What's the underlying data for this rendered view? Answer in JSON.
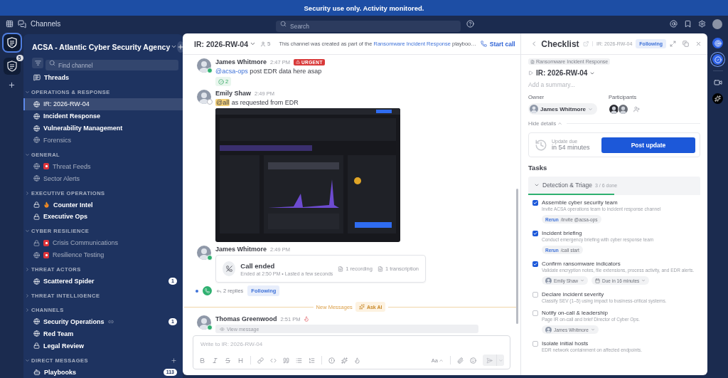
{
  "banner": {
    "text": "Security use only. Activity monitored."
  },
  "top_bar": {
    "product": "Channels",
    "search_placeholder": "Search"
  },
  "teams": [
    {
      "selected": true
    },
    {
      "selected": false,
      "badge": "5"
    }
  ],
  "sidebar": {
    "team_name": "ACSA - Atlantic Cyber Security Agency",
    "find_placeholder": "Find channel",
    "threads": "Threads",
    "sections": [
      {
        "title": "OPERATIONS & RESPONSE",
        "expanded": true,
        "channels": [
          {
            "name": "IR: 2026-RW-04",
            "kind": "public",
            "unread": false,
            "selected": true
          },
          {
            "name": "Incident Response",
            "kind": "public",
            "unread": true,
            "selected": false
          },
          {
            "name": "Vulnerability Management",
            "kind": "public",
            "unread": true,
            "selected": false
          },
          {
            "name": "Forensics",
            "kind": "public",
            "unread": false,
            "selected": false
          }
        ]
      },
      {
        "title": "GENERAL",
        "expanded": true,
        "channels": [
          {
            "name": "Threat Feeds",
            "kind": "public",
            "flagged": true,
            "unread": false,
            "selected": false
          },
          {
            "name": "Sector Alerts",
            "kind": "public",
            "unread": false,
            "selected": false
          }
        ]
      },
      {
        "title": "EXECUTIVE OPERATIONS",
        "expanded": false,
        "channels": [
          {
            "name": "Counter Intel",
            "kind": "private",
            "hot": true,
            "unread": true,
            "selected": false
          },
          {
            "name": "Executive Ops",
            "kind": "private",
            "unread": true,
            "selected": false
          }
        ]
      },
      {
        "title": "CYBER RESILIENCE",
        "expanded": true,
        "channels": [
          {
            "name": "Crisis Communications",
            "kind": "private",
            "flagged": true,
            "unread": false,
            "selected": false
          },
          {
            "name": "Resilience Testing",
            "kind": "public",
            "flagged": true,
            "unread": false,
            "selected": false
          }
        ]
      },
      {
        "title": "THREAT ACTORS",
        "expanded": false,
        "channels": [
          {
            "name": "Scattered Spider",
            "kind": "public",
            "unread": true,
            "selected": false,
            "badge": "1"
          }
        ]
      },
      {
        "title": "THREAT INTELLIGENCE",
        "expanded": false
      },
      {
        "title": "CHANNELS",
        "expanded": false,
        "channels": [
          {
            "name": "Security Operations",
            "kind": "public",
            "unread": true,
            "selected": false,
            "shared": true,
            "badge": "1"
          },
          {
            "name": "Red Team",
            "kind": "public",
            "unread": true,
            "selected": false
          },
          {
            "name": "Legal Review",
            "kind": "private",
            "unread": true,
            "selected": false
          }
        ]
      },
      {
        "title": "DIRECT MESSAGES",
        "expanded": true,
        "addable": true,
        "channels": [
          {
            "name": "Playbooks",
            "kind": "bot",
            "unread": true,
            "selected": false,
            "badge": "113"
          }
        ]
      }
    ]
  },
  "channel_header": {
    "name": "IR: 2026-RW-04",
    "members": "5",
    "description_before": "This channel was created as part of the ",
    "description_link": "Ransomware Incident Response",
    "description_after": " playboo…",
    "call_button": "Start call"
  },
  "messages": [
    {
      "kind": "post",
      "author": "James Whitmore",
      "time": "2:47 PM",
      "online": true,
      "badge": "URGENT",
      "mention": "@acsa-ops",
      "highlighted": false,
      "text": " post EDR data here asap",
      "reaction": "2"
    },
    {
      "kind": "post",
      "author": "Emily Shaw",
      "time": "2:49 PM",
      "online": false,
      "mention": "@all",
      "highlighted": true,
      "text": " as requested from EDR"
    },
    {
      "kind": "post",
      "author": "James Whitmore",
      "time": "2:49 PM",
      "online": true,
      "call": {
        "title": "Call ended",
        "subtitle": "Ended at 2:50 PM • Lasted a few seconds",
        "recording": "1 recording",
        "transcription": "1 transcription"
      },
      "thread": {
        "unread": true,
        "replies": "2 replies",
        "following": "Following"
      }
    },
    {
      "kind": "separator",
      "label": "New Messages",
      "ask_ai": "Ask AI"
    },
    {
      "kind": "post",
      "author": "Thomas Greenwood",
      "time": "2:51 PM",
      "online": true,
      "burn": true,
      "hidden": "View message"
    }
  ],
  "composer": {
    "placeholder": "Write to IR: 2026-RW-04",
    "format": "Aa"
  },
  "rhs": {
    "title": "Checklist",
    "channel": "IR: 2026-RW-04",
    "following": "Following",
    "playbook": "Ransomware Incident Response",
    "run_name": "IR: 2026-RW-04",
    "summary_placeholder": "Add a summary...",
    "owner_label": "Owner",
    "owner": "James Whitmore",
    "participants_label": "Participants",
    "participants": [
      {
        "kind": "avatar"
      },
      {
        "kind": "avatar"
      }
    ],
    "details_toggle": "Hide details",
    "update_label": "Update due",
    "update_due": "in 54 minutes",
    "post_update": "Post update",
    "tasks_title": "Tasks",
    "checklist": {
      "name": "Detection & Triage",
      "progress": "3 / 6 done",
      "expanded": true,
      "level": 0.5
    },
    "tasks": [
      {
        "title": "Assemble cyber security team",
        "description": "Invite ACSA operations team to incident response channel",
        "checked": true,
        "command": {
          "label": "Rerun",
          "text": "/invite @acsa-ops"
        }
      },
      {
        "title": "Incident briefing",
        "description": "Conduct emergency briefing with cyber response team",
        "checked": true,
        "command": {
          "label": "Rerun",
          "text": "/call start"
        }
      },
      {
        "title": "Confirm ransomware indicators",
        "description": "Validate encryption notes, file extensions, process activity, and EDR alerts.",
        "checked": true,
        "assignee": "Emily Shaw",
        "due": "Due in 16 minutes"
      },
      {
        "title": "Declare incident severity",
        "description": "Classify SEV (1–5) using impact to business-critical systems.",
        "checked": false
      },
      {
        "title": "Notify on-call & leadership",
        "description": "Page IR on-call and brief Director of Cyber Ops.",
        "checked": false,
        "assignee": "James Whitmore"
      },
      {
        "title": "Isolate initial hosts",
        "description": "EDR network containment on affected endpoints.",
        "checked": false
      }
    ]
  },
  "app_bar": [
    {
      "kind": "target",
      "selected": false
    },
    {
      "kind": "checklist",
      "selected": true
    },
    {
      "kind": "video",
      "selected": false
    },
    {
      "kind": "ai",
      "selected": false
    }
  ]
}
